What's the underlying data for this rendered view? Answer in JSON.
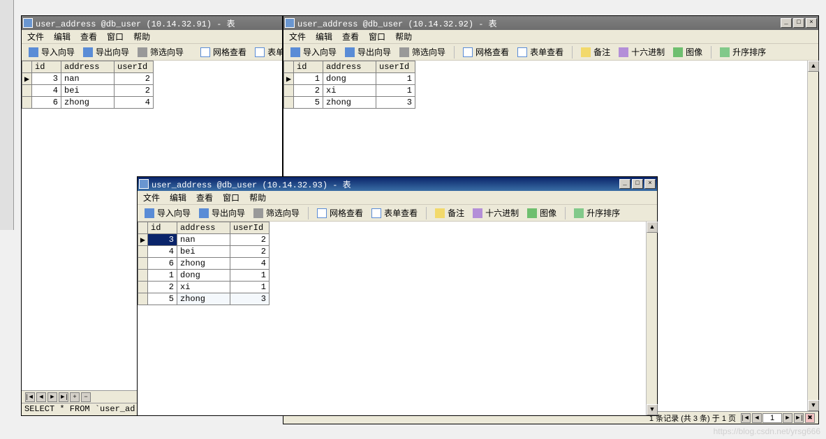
{
  "menu": [
    "文件",
    "编辑",
    "查看",
    "窗口",
    "帮助"
  ],
  "tools": {
    "import": "导入向导",
    "export": "导出向导",
    "filter": "筛选向导",
    "gridview": "网格查看",
    "formview": "表单查看",
    "memo": "备注",
    "hex": "十六进制",
    "image": "图像",
    "sort": "升序排序",
    "formview_short": "表单"
  },
  "columns": [
    "id",
    "address",
    "userId"
  ],
  "win1": {
    "title": "user_address @db_user (10.14.32.91) - 表",
    "rows": [
      {
        "id": 3,
        "address": "nan",
        "userId": 2
      },
      {
        "id": 4,
        "address": "bei",
        "userId": 2
      },
      {
        "id": 6,
        "address": "zhong",
        "userId": 4
      }
    ],
    "sql": "SELECT * FROM `user_ad"
  },
  "win2": {
    "title": "user_address @db_user (10.14.32.92) - 表",
    "rows": [
      {
        "id": 1,
        "address": "dong",
        "userId": 1
      },
      {
        "id": 2,
        "address": "xi",
        "userId": 1
      },
      {
        "id": 5,
        "address": "zhong",
        "userId": 3
      }
    ],
    "nav_page": "1",
    "status": "1 条记录 (共 3 条) 于 1 页"
  },
  "win3": {
    "title": "user_address @db_user (10.14.32.93) - 表",
    "rows": [
      {
        "id": 3,
        "address": "nan",
        "userId": 2,
        "sel": true
      },
      {
        "id": 4,
        "address": "bei",
        "userId": 2
      },
      {
        "id": 6,
        "address": "zhong",
        "userId": 4
      },
      {
        "id": 1,
        "address": "dong",
        "userId": 1
      },
      {
        "id": 2,
        "address": "xi",
        "userId": 1
      },
      {
        "id": 5,
        "address": "zhong",
        "userId": 3,
        "alt": true
      }
    ]
  },
  "watermark": "https://blog.csdn.net/yrsg666"
}
